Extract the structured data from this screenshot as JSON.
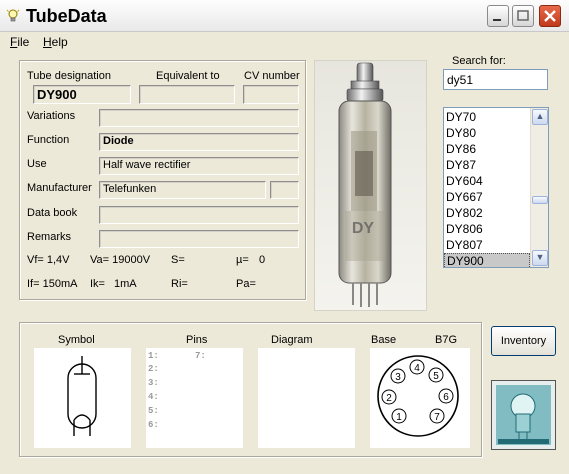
{
  "window": {
    "title": "TubeData"
  },
  "menu": {
    "items": [
      "File",
      "Help"
    ]
  },
  "tube": {
    "designation_label": "Tube designation",
    "equivalent_label": "Equivalent to",
    "cv_label": "CV number",
    "designation_value": "DY900",
    "equivalent_value": "",
    "cv_value": "",
    "variations_label": "Variations",
    "variations_value": "",
    "function_label": "Function",
    "function_value": "Diode",
    "use_label": "Use",
    "use_value": "Half wave rectifier",
    "manufacturer_label": "Manufacturer",
    "manufacturer_value": "Telefunken",
    "manufacturer_extra": "",
    "databook_label": "Data book",
    "databook_value": "",
    "remarks_label": "Remarks",
    "remarks_value": ""
  },
  "params": {
    "vf": "Vf= 1,4V",
    "va": "Va= 19000V",
    "s": "S=",
    "mu": "µ=",
    "mu_value": "0",
    "if": "If= 150mA",
    "ik": "Ik=",
    "ik_value": "1mA",
    "ri": "Ri=",
    "pa": "Pa="
  },
  "search": {
    "label": "Search for:",
    "value": "dy51"
  },
  "list": {
    "items": [
      "DY70",
      "DY80",
      "DY86",
      "DY87",
      "DY604",
      "DY667",
      "DY802",
      "DY806",
      "DY807",
      "DY900"
    ],
    "selected": "DY900"
  },
  "bottom": {
    "symbol_label": "Symbol",
    "pins_label": "Pins",
    "diagram_label": "Diagram",
    "base_label": "Base",
    "base_type": "B7G",
    "pins": [
      "1:",
      "2:",
      "3:",
      "4:",
      "5:",
      "6:",
      "7:"
    ],
    "base_pins": [
      "1",
      "2",
      "3",
      "4",
      "5",
      "6",
      "7"
    ]
  },
  "buttons": {
    "inventory": "Inventory"
  },
  "colors": {
    "window_bg": "#ece9d8",
    "selection": "#c8c8c8",
    "close_button": "#d34a2a"
  }
}
